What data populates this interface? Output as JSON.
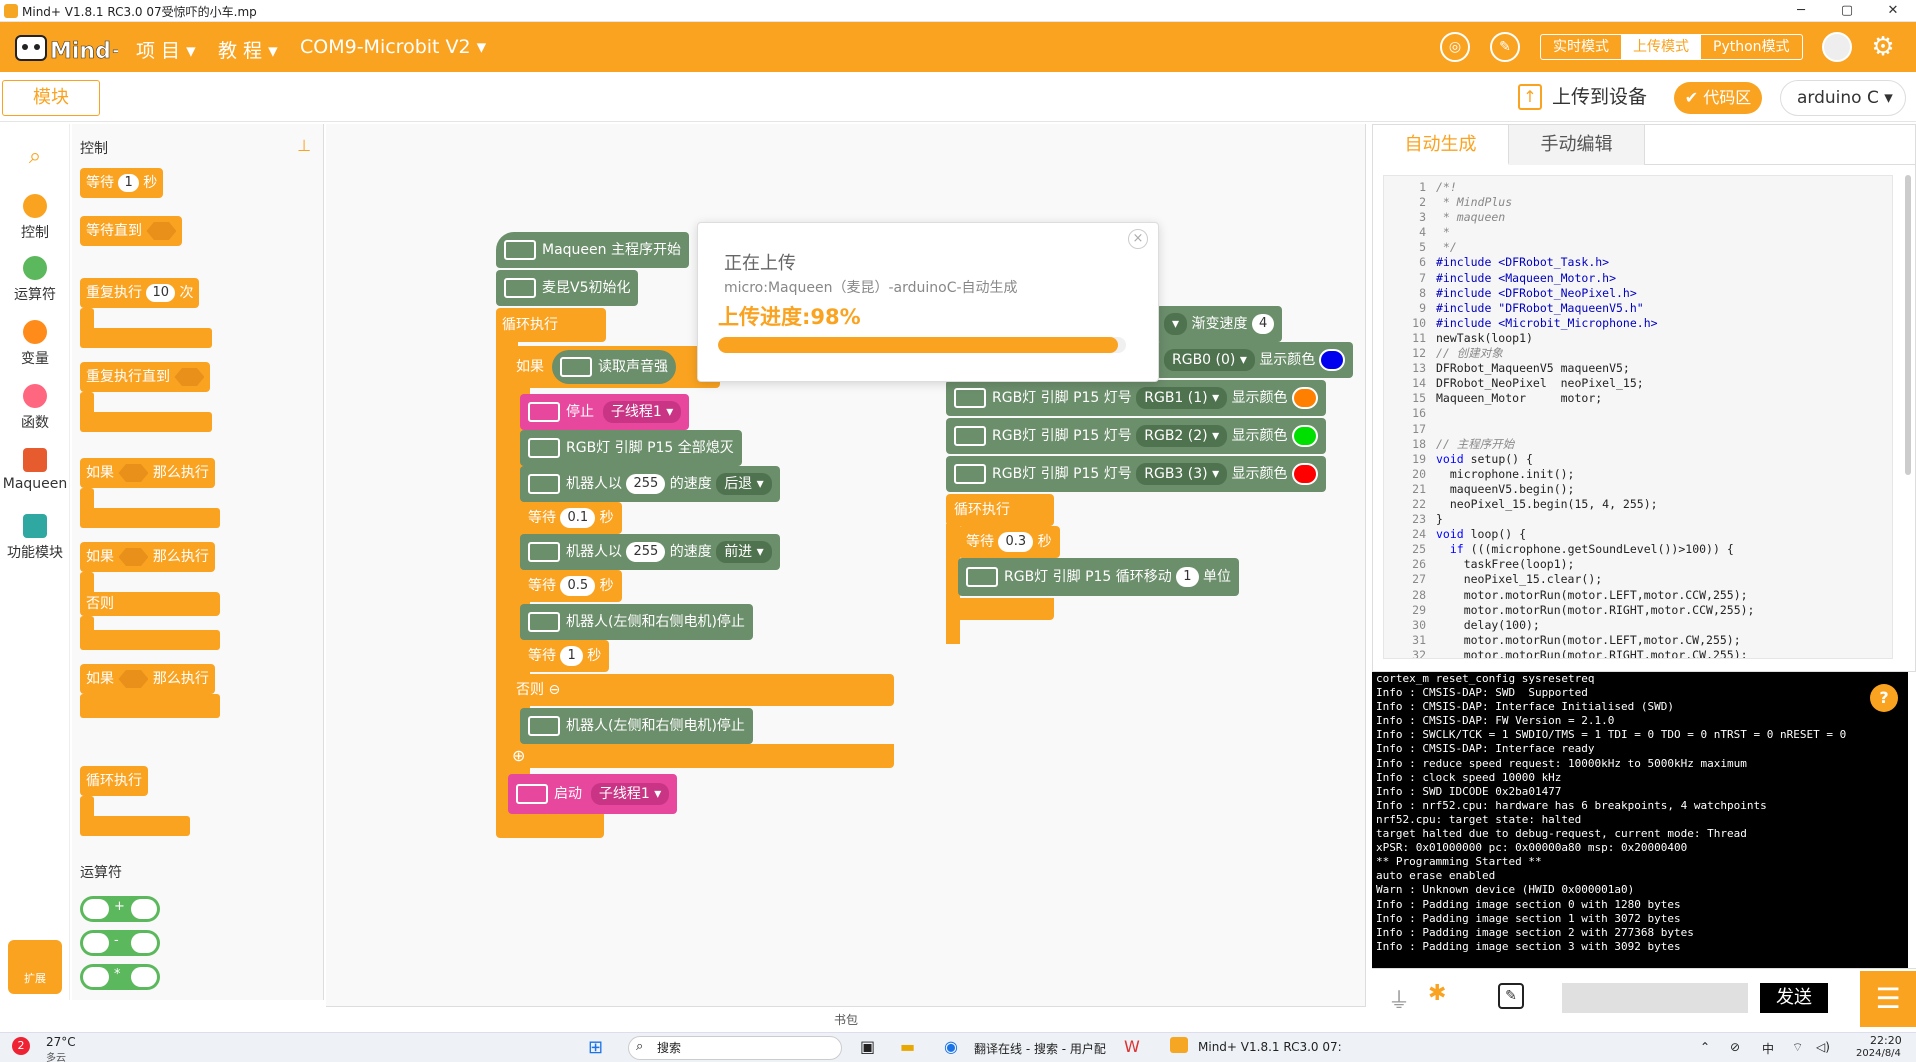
{
  "window": {
    "title": "Mind+ V1.8.1 RC3.0   07受惊吓的小车.mp",
    "minimize": "─",
    "maximize": "▢",
    "close": "✕"
  },
  "header": {
    "menu_project": "项 目 ▾",
    "menu_tutorial": "教 程 ▾",
    "menu_device": "COM9-Microbit V2 ▾",
    "mode_realtime": "实时模式",
    "mode_upload": "上传模式",
    "mode_python": "Python模式"
  },
  "toolbar": {
    "modules_tab": "模块",
    "upload": "上传到设备",
    "code_area": "代码区",
    "language": "arduino C ▾"
  },
  "categories": [
    {
      "label": "控制",
      "color": "#faa321"
    },
    {
      "label": "运算符",
      "color": "#5cb85c"
    },
    {
      "label": "变量",
      "color": "#ff8c1a"
    },
    {
      "label": "函数",
      "color": "#ff6680"
    },
    {
      "label": "Maqueen",
      "color": "#e65c2e"
    },
    {
      "label": "功能模块",
      "color": "#2ea8a0"
    }
  ],
  "extension": "扩展",
  "palette": {
    "section_control": "控制",
    "wait": "等待",
    "wait_val": "1",
    "sec": "秒",
    "wait_until": "等待直到",
    "repeat": "重复执行",
    "repeat_val": "10",
    "times": "次",
    "repeat_until": "重复执行直到",
    "if": "如果",
    "then": "那么执行",
    "else": "否则",
    "forever": "循环执行",
    "section_ops": "运算符",
    "op_add": "+",
    "op_sub": "-",
    "op_mul": "*"
  },
  "blocks": {
    "main_start": "Maqueen 主程序开始",
    "init": "麦昆V5初始化",
    "loop": "循环执行",
    "if": "如果",
    "read_sound": "读取声音强",
    "stop_thread": "停止",
    "thread1": "子线程1 ▾",
    "rgb_all_off": "RGB灯 引脚 P15 全部熄灭",
    "robot_move1": "机器人以",
    "speed1": "255",
    "speed_of": "的速度",
    "dir_back": "后退 ▾",
    "wait": "等待",
    "wait1": "0.1",
    "wait2": "0.5",
    "wait3": "1",
    "sec": "秒",
    "robot_dir2": "前进 ▾",
    "robot_stop": "机器人(左侧和右侧电机)停止",
    "else": "否则",
    "start_thread": "启动",
    "gradient": "渐变速度",
    "gradient_val": "4",
    "rgb_pin": "RGB灯 引脚 P15 灯号",
    "rgb0": "RGB0 (0) ▾",
    "rgb1": "RGB1 (1) ▾",
    "rgb2": "RGB2 (2) ▾",
    "rgb3": "RGB3 (3) ▾",
    "show_color": "显示颜色",
    "loop2": "循环执行",
    "wait4": "0.3",
    "rgb_shift": "RGB灯 引脚 P15 循环移动",
    "shift_val": "1",
    "unit": "单位",
    "colors": [
      "#0000ee",
      "#ff7f00",
      "#00e000",
      "#ff0000"
    ]
  },
  "workspace_tools": {
    "undo": "↶",
    "redo": "↷",
    "crop": "⌗",
    "zoom_in": "+",
    "zoom_out": "−",
    "reset": "="
  },
  "bookbag": "书包",
  "upload_modal": {
    "title": "正在上传",
    "subtitle": "micro:Maqueen（麦昆）-arduinoC-自动生成",
    "progress_text": "上传进度:98%",
    "progress": 0.98,
    "close": "×"
  },
  "code_tabs": {
    "auto": "自动生成",
    "manual": "手动编辑"
  },
  "code_lines": [
    "/*!",
    " * MindPlus",
    " * maqueen",
    " *",
    " */",
    "#include <DFRobot_Task.h>",
    "#include <Maqueen_Motor.h>",
    "#include <DFRobot_NeoPixel.h>",
    "#include \"DFRobot_MaqueenV5.h\"",
    "#include <Microbit_Microphone.h>",
    "newTask(loop1)",
    "// 创建对象",
    "DFRobot_MaqueenV5 maqueenV5;",
    "DFRobot_NeoPixel  neoPixel_15;",
    "Maqueen_Motor     motor;",
    "",
    "",
    "// 主程序开始",
    "void setup() {",
    "  microphone.init();",
    "  maqueenV5.begin();",
    "  neoPixel_15.begin(15, 4, 255);",
    "}",
    "void loop() {",
    "  if (((microphone.getSoundLevel())>100)) {",
    "    taskFree(loop1);",
    "    neoPixel_15.clear();",
    "    motor.motorRun(motor.LEFT,motor.CCW,255);",
    "    motor.motorRun(motor.RIGHT,motor.CCW,255);",
    "    delay(100);",
    "    motor.motorRun(motor.LEFT,motor.CW,255);",
    "    motor.motorRun(motor.RIGHT,motor.CW,255);"
  ],
  "console_lines": [
    "cortex_m reset_config sysresetreq",
    "Info : CMSIS-DAP: SWD  Supported",
    "Info : CMSIS-DAP: Interface Initialised (SWD)",
    "Info : CMSIS-DAP: FW Version = 2.1.0",
    "Info : SWCLK/TCK = 1 SWDIO/TMS = 1 TDI = 0 TDO = 0 nTRST = 0 nRESET = 0",
    "Info : CMSIS-DAP: Interface ready",
    "Info : reduce speed request: 10000kHz to 5000kHz maximum",
    "Info : clock speed 10000 kHz",
    "Info : SWD IDCODE 0x2ba01477",
    "Info : nrf52.cpu: hardware has 6 breakpoints, 4 watchpoints",
    "nrf52.cpu: target state: halted",
    "target halted due to debug-request, current mode: Thread",
    "xPSR: 0x01000000 pc: 0x00000a80 msp: 0x20000400",
    "** Programming Started **",
    "auto erase enabled",
    "Warn : Unknown device (HWID 0x000001a0)",
    "Info : Padding image section 0 with 1280 bytes",
    "Info : Padding image section 1 with 3072 bytes",
    "Info : Padding image section 2 with 277368 bytes",
    "Info : Padding image section 3 with 3092 bytes"
  ],
  "serial": {
    "send": "发送",
    "help": "?"
  },
  "taskbar": {
    "weather": "27°C",
    "weather_sub": "多云",
    "badge": "2",
    "search": "搜索",
    "browser_tab": "翻译在线 - 搜索 - 用户配",
    "app_tab": "Mind+ V1.8.1 RC3.0  07:",
    "ime": "中",
    "time": "22:20",
    "date": "2024/8/4"
  }
}
